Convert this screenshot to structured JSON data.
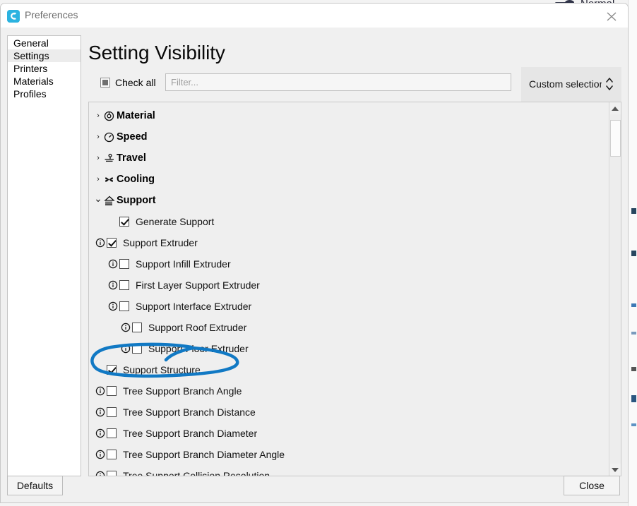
{
  "window": {
    "title": "Preferences",
    "app_icon": "cura-logo-icon",
    "close_icon": "close-icon"
  },
  "background": {
    "visible_label": "Normal"
  },
  "nav": {
    "items": [
      {
        "label": "General",
        "selected": false
      },
      {
        "label": "Settings",
        "selected": true
      },
      {
        "label": "Printers",
        "selected": false
      },
      {
        "label": "Materials",
        "selected": false
      },
      {
        "label": "Profiles",
        "selected": false
      }
    ]
  },
  "main": {
    "page_title": "Setting Visibility",
    "check_all": {
      "label": "Check all",
      "state": "partial"
    },
    "filter": {
      "value": "",
      "placeholder": "Filter..."
    },
    "preset": {
      "selected": "Custom selection",
      "icon": "updown-arrows-icon"
    }
  },
  "tree": {
    "rows": [
      {
        "kind": "category",
        "label": "Material",
        "expanded": false,
        "chevron": "chevron-right-icon",
        "icon": "material-spool-icon"
      },
      {
        "kind": "category",
        "label": "Speed",
        "expanded": false,
        "chevron": "chevron-right-icon",
        "icon": "speed-gauge-icon"
      },
      {
        "kind": "category",
        "label": "Travel",
        "expanded": false,
        "chevron": "chevron-right-icon",
        "icon": "travel-icon"
      },
      {
        "kind": "category",
        "label": "Cooling",
        "expanded": false,
        "chevron": "chevron-right-icon",
        "icon": "cooling-fan-icon"
      },
      {
        "kind": "category",
        "label": "Support",
        "expanded": true,
        "chevron": "chevron-down-icon",
        "icon": "support-icon"
      },
      {
        "kind": "setting",
        "label": "Generate Support",
        "checked": true,
        "info": false,
        "indent": 0
      },
      {
        "kind": "setting",
        "label": "Support Extruder",
        "checked": true,
        "info": true,
        "indent": 0
      },
      {
        "kind": "setting",
        "label": "Support Infill Extruder",
        "checked": false,
        "info": true,
        "indent": 1
      },
      {
        "kind": "setting",
        "label": "First Layer Support Extruder",
        "checked": false,
        "info": true,
        "indent": 1
      },
      {
        "kind": "setting",
        "label": "Support Interface Extruder",
        "checked": false,
        "info": true,
        "indent": 1
      },
      {
        "kind": "setting",
        "label": "Support Roof Extruder",
        "checked": false,
        "info": true,
        "indent": 2
      },
      {
        "kind": "setting",
        "label": "Support Floor Extruder",
        "checked": false,
        "info": true,
        "indent": 2
      },
      {
        "kind": "setting",
        "label": "Support Structure",
        "checked": true,
        "info": false,
        "indent": 0,
        "annotated": true
      },
      {
        "kind": "setting",
        "label": "Tree Support Branch Angle",
        "checked": false,
        "info": true,
        "indent": 0
      },
      {
        "kind": "setting",
        "label": "Tree Support Branch Distance",
        "checked": false,
        "info": true,
        "indent": 0
      },
      {
        "kind": "setting",
        "label": "Tree Support Branch Diameter",
        "checked": false,
        "info": true,
        "indent": 0
      },
      {
        "kind": "setting",
        "label": "Tree Support Branch Diameter Angle",
        "checked": false,
        "info": true,
        "indent": 0
      },
      {
        "kind": "setting",
        "label": "Tree Support Collision Resolution",
        "checked": false,
        "info": true,
        "indent": 0
      }
    ],
    "scrollbar": {
      "up_icon": "scroll-up-arrow-icon",
      "down_icon": "scroll-down-arrow-icon"
    }
  },
  "footer": {
    "defaults_label": "Defaults",
    "close_label": "Close"
  },
  "annotation": {
    "shape": "hand-drawn-blue-ellipse",
    "color": "#1179c4",
    "targets": "Support Structure"
  }
}
